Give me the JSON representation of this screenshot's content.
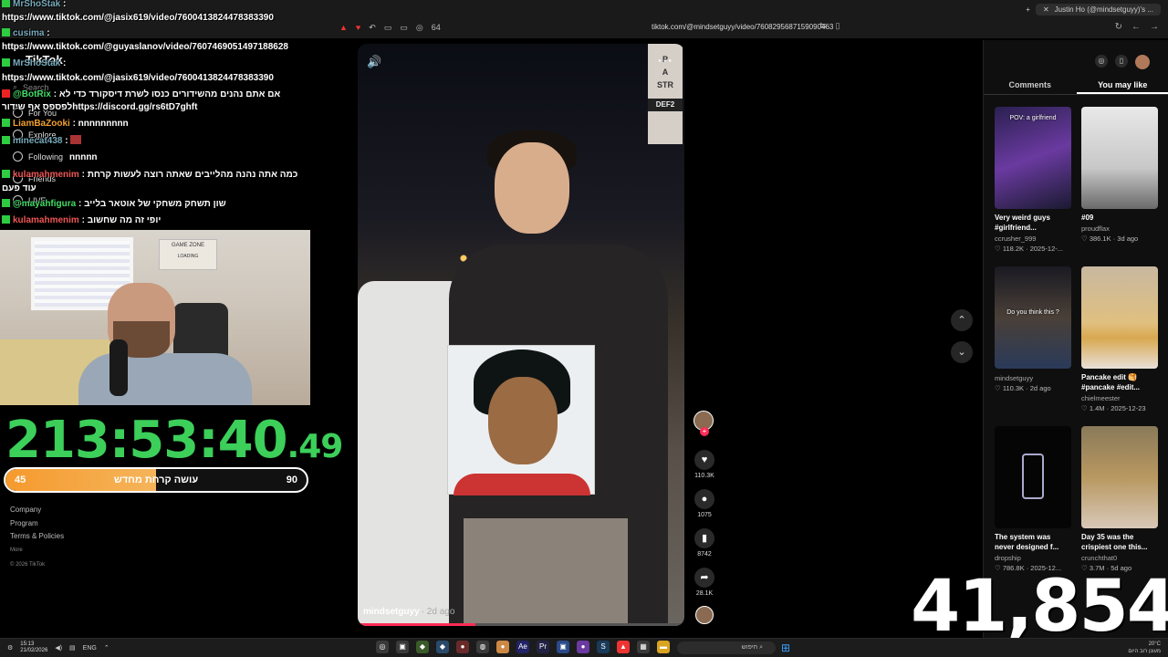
{
  "browser": {
    "url": "tiktok.com/@mindsetguyy/video/7608295687159090463",
    "tab_title": "Justin Ho (@mindsetguyy)'s ...",
    "toolbar_count": "64"
  },
  "chat": [
    {
      "user": "MrShoStak",
      "msg": ":",
      "color": "uname"
    },
    {
      "user": "",
      "msg": "https://www.tiktok.com/@jasix619/video/7600413824478383390",
      "color": ""
    },
    {
      "user": "cusima",
      "msg": ":",
      "color": "uname"
    },
    {
      "user": "",
      "msg": "https://www.tiktok.com/@guyaslanov/video/7607469051497188628",
      "color": ""
    },
    {
      "user": "MrShoStak",
      "msg": ":",
      "color": "uname"
    },
    {
      "user": "",
      "msg": "https://www.tiktok.com/@jasix619/video/7600413824478383390",
      "color": ""
    },
    {
      "user": "@BotRix",
      "msg": ": אם אתם נהנים מהשידורים כנסו לשרת דיסקורד כדי לא לפספס אף שידורhttps://discord.gg/rs6tD7ghft",
      "color": "uname g"
    },
    {
      "user": "LiamBaZooki",
      "msg": ": nnnnnnnnn",
      "color": "uname o"
    },
    {
      "user": "minecat438",
      "msg": ":",
      "color": "uname"
    },
    {
      "user": "",
      "msg": "nnnnn",
      "color": ""
    },
    {
      "user": "kulamahmenim",
      "msg": ": כמה אתה נהנה מהלייבים שאתה רוצה לעשות קרחת עוד פעם",
      "color": "uname p"
    },
    {
      "user": "@mayahfigura",
      "msg": ": שון תשחק משחקי של אוטאר בלייב",
      "color": "uname g"
    },
    {
      "user": "kulamahmenim",
      "msg": ": יופי זה מה שחשוב",
      "color": "uname p"
    }
  ],
  "tiktok_nav": {
    "logo": "TikTok",
    "search": "Search",
    "items": [
      "For You",
      "Explore",
      "Following",
      "Friends",
      "LIVE"
    ]
  },
  "webcam": {
    "sign_text": "GAME ZONE",
    "sign_sub": "LOADING"
  },
  "timer": {
    "main": "213:53:40",
    "ms": ".49"
  },
  "goal": {
    "current": "45",
    "target": "90",
    "label": "עושה קרחת מחדש",
    "fraction": 0.5
  },
  "footer": {
    "links": [
      "Company",
      "Program",
      "Terms & Policies"
    ],
    "more": "More",
    "copyright": "© 2026 TikTok"
  },
  "video": {
    "author": "mindsetguyy",
    "date": "· 2d ago",
    "sign_letters": [
      "P",
      "A",
      "STR"
    ],
    "sign_label": "DEF2",
    "progress": 0.36
  },
  "actions": {
    "likes": "110.3K",
    "comments": "1075",
    "saves": "8742",
    "shares": "28.1K"
  },
  "panel": {
    "tabs": [
      "Comments",
      "You may like"
    ],
    "active_tab": 1,
    "cards": [
      {
        "title": "Very weird guys",
        "title2": "#girlfriend...",
        "user": "ccrusher_999",
        "likes": "118.2K",
        "date": "2025-12-...",
        "caption": "POV: a girlfriend"
      },
      {
        "title": "#09",
        "title2": "",
        "user": "proudflax",
        "likes": "386.1K",
        "date": "3d ago",
        "caption": ""
      },
      {
        "title": "",
        "title2": "",
        "user": "mindsetguyy",
        "likes": "110.3K",
        "date": "2d ago",
        "caption": "Do you think this ?"
      },
      {
        "title": "Pancake edit 🥞",
        "title2": "#pancake #edit...",
        "user": "chielmeester",
        "likes": "1.4M",
        "date": "2025-12-23",
        "caption": ""
      },
      {
        "title": "The system was",
        "title2": "never designed f...",
        "user": "dropship",
        "likes": "786.8K",
        "date": "2025-12...",
        "caption": ""
      },
      {
        "title": "Day 35 was the",
        "title2": "crispiest one this...",
        "user": "crunchthat0",
        "likes": "3.7M",
        "date": "5d ago",
        "caption": ""
      }
    ]
  },
  "big_counter": "41,854",
  "taskbar": {
    "time": "15:13",
    "date": "21/02/2026",
    "lang": "ENG",
    "search": "חיפוש",
    "weather": "20°C",
    "weather_sub": "מעונן רוב היום"
  }
}
